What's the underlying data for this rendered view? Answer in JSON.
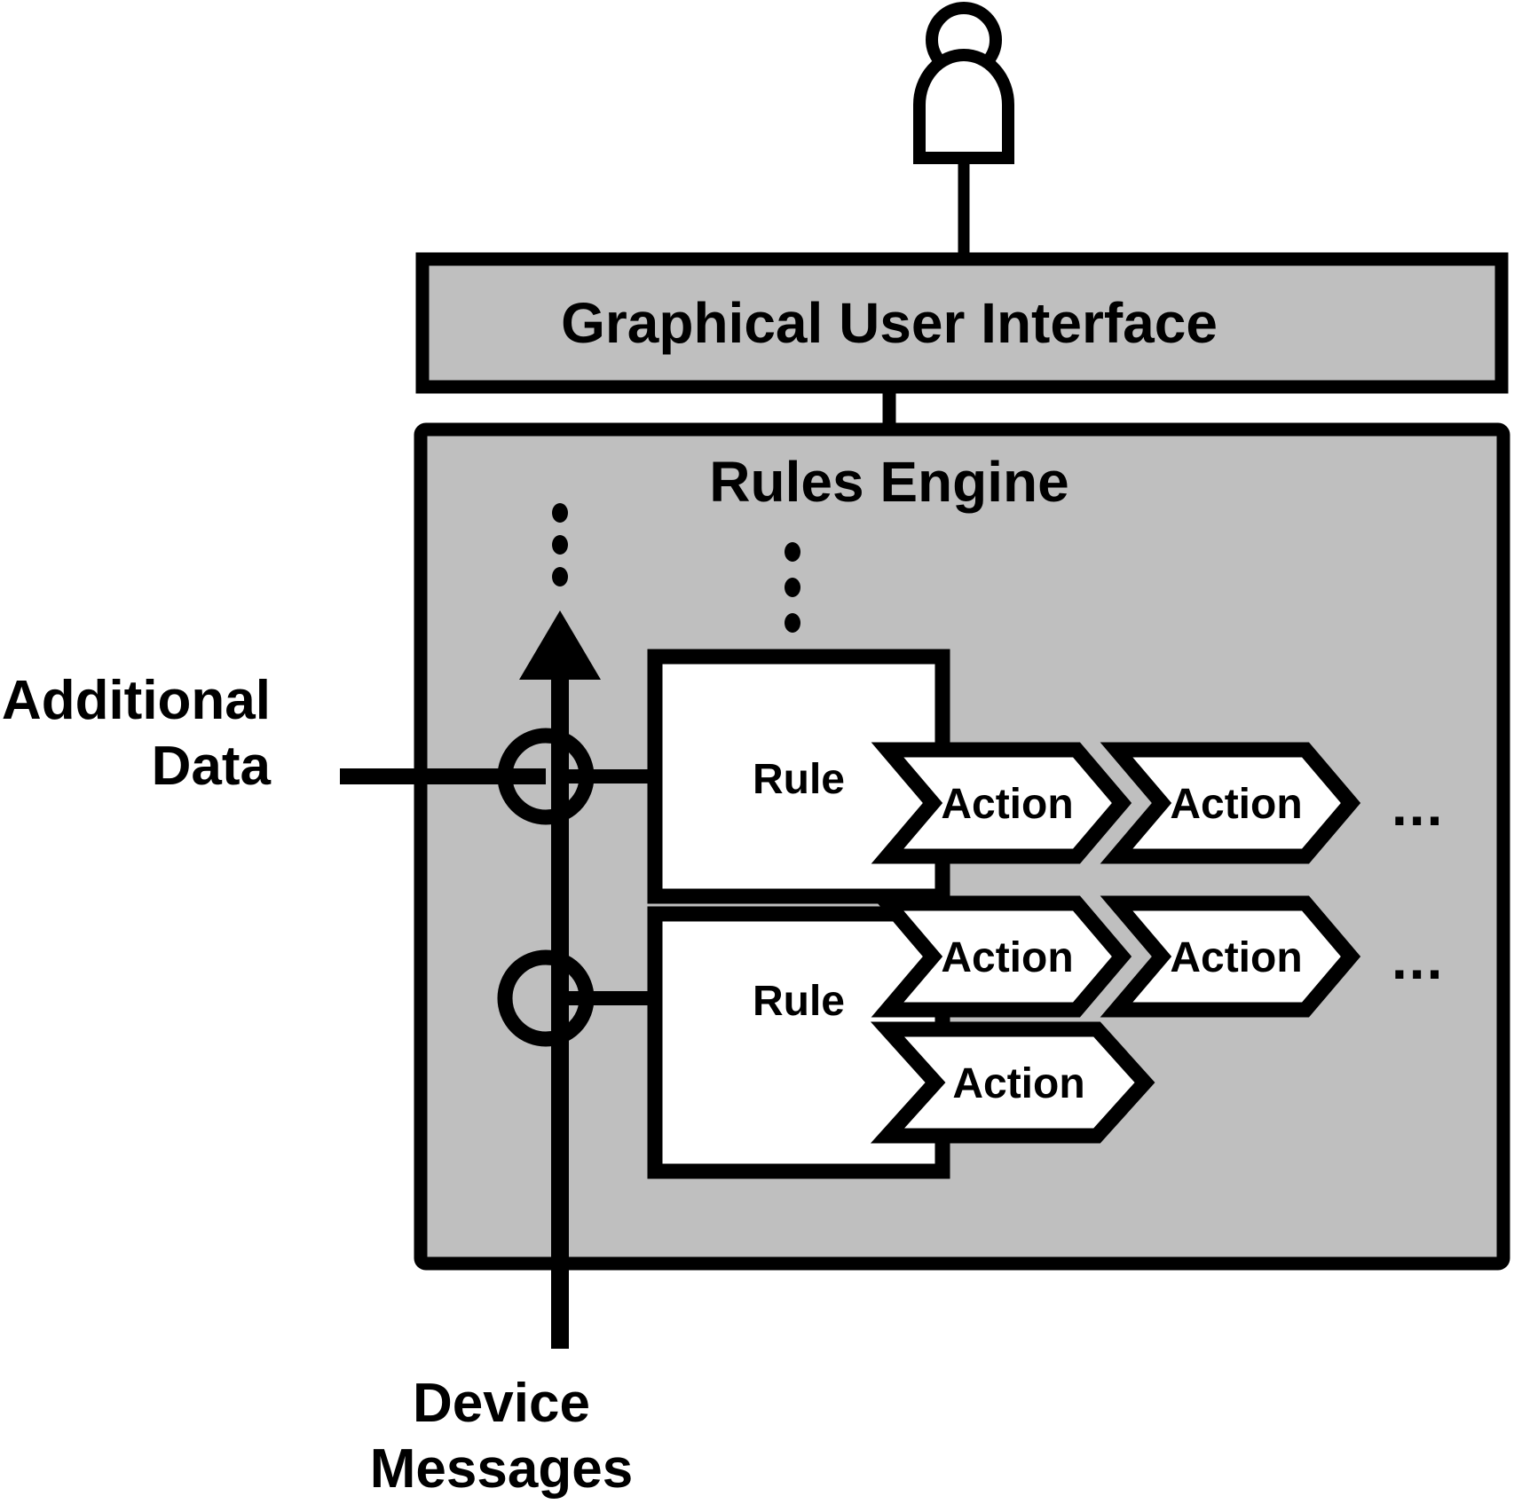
{
  "diagram": {
    "title": "Rules Engine architecture diagram",
    "colors": {
      "container_fill": "#BFBFBF",
      "box_fill": "#FFFFFF",
      "stroke": "#000000",
      "page_background": "#FFFFFF"
    },
    "actor": {
      "name": "user-actor",
      "icon": "person-actor-icon"
    },
    "gui_box": {
      "label": "Graphical User Interface"
    },
    "rules_engine_box": {
      "label": "Rules Engine"
    },
    "external_inputs": [
      {
        "id": "additional-data",
        "line1": "Additional",
        "line2": "Data",
        "label": "Additional Data"
      },
      {
        "id": "device-messages",
        "line1": "Device",
        "line2": "Messages",
        "label": "Device Messages"
      }
    ],
    "vertical_ellipsis_top": "⋮",
    "vertical_ellipsis_rules": "⋮",
    "horizontal_ellipsis": "...",
    "rules": [
      {
        "id": "rule-1",
        "label": "Rule",
        "actions": [
          {
            "label": "Action"
          },
          {
            "label": "Action"
          }
        ],
        "has_more_actions": true,
        "more_actions_label": "..."
      },
      {
        "id": "rule-2",
        "label": "Rule",
        "action_rows": [
          {
            "actions": [
              {
                "label": "Action"
              },
              {
                "label": "Action"
              }
            ],
            "has_more_actions": true,
            "more_actions_label": "..."
          },
          {
            "actions": [
              {
                "label": "Action"
              }
            ],
            "has_more_actions": false
          }
        ]
      }
    ]
  }
}
